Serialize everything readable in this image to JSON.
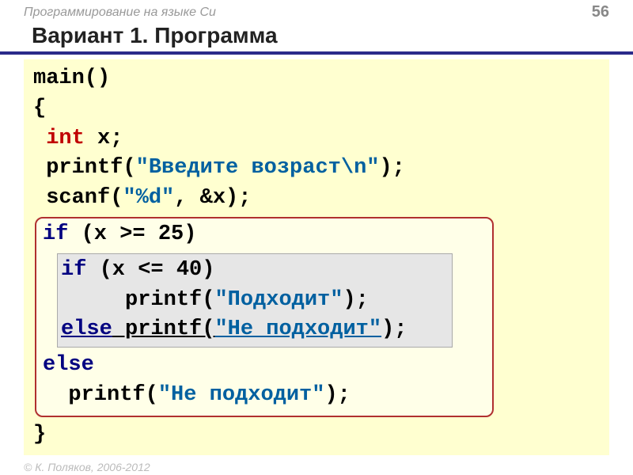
{
  "header": {
    "topic": "Программирование на языке Си",
    "page": "56"
  },
  "title": "Вариант 1. Программа",
  "code": {
    "l1_a": "main()",
    "l2_a": "{",
    "l3_kw": " int",
    "l3_b": " x;",
    "l4_a": " printf(",
    "l4_str": "\"Введите возраст\\n\"",
    "l4_b": ");",
    "l5_a": " scanf(",
    "l5_str": "\"%d\"",
    "l5_b": ", &x);",
    "ob_l1_kw": "if",
    "ob_l1_b": " (x >= 25)",
    "ib_l1_kw": "if",
    "ib_l1_b": " (x <= 40)",
    "ib_l2_a": "     printf(",
    "ib_l2_str": "\"Подходит\"",
    "ib_l2_b": ");",
    "ib_l3_kw": "else",
    "ib_l3_a": " printf(",
    "ib_l3_str": "\"Не подходит\"",
    "ib_l3_b": ");",
    "ob_l2_kw": "else",
    "ob_l3_a": "  printf(",
    "ob_l3_str": "\"Не подходит\"",
    "ob_l3_b": ");",
    "last": "}"
  },
  "footer": "© К. Поляков, 2006-2012"
}
